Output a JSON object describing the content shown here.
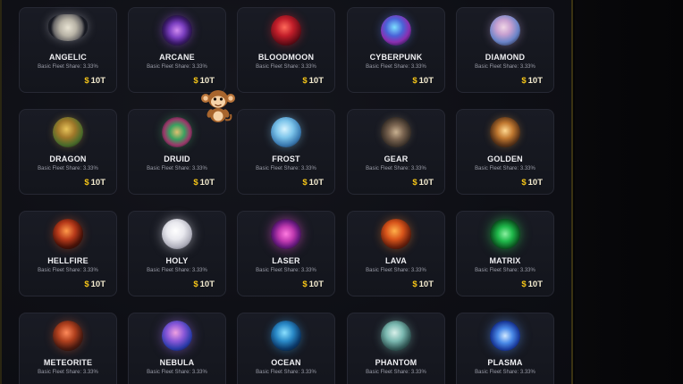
{
  "colors": {
    "accent_gold": "#f5c518",
    "card_bg": "#171922",
    "panel_border": "#3a3212"
  },
  "currency_symbol": "$",
  "cards": [
    {
      "name": "ANGELIC",
      "share": "Basic Fleet Share: 3.33%",
      "price": "10T",
      "icon": "angelic-wings-orb-icon"
    },
    {
      "name": "ARCANE",
      "share": "Basic Fleet Share: 3.33%",
      "price": "10T",
      "icon": "arcane-orb-icon"
    },
    {
      "name": "BLOODMOON",
      "share": "Basic Fleet Share: 3.33%",
      "price": "10T",
      "icon": "bloodmoon-orb-icon"
    },
    {
      "name": "CYBERPUNK",
      "share": "Basic Fleet Share: 3.33%",
      "price": "10T",
      "icon": "cyberpunk-orb-icon"
    },
    {
      "name": "DIAMOND",
      "share": "Basic Fleet Share: 3.33%",
      "price": "10T",
      "icon": "diamond-orb-icon"
    },
    {
      "name": "DRAGON",
      "share": "Basic Fleet Share: 3.33%",
      "price": "10T",
      "icon": "dragon-orb-icon"
    },
    {
      "name": "DRUID",
      "share": "Basic Fleet Share: 3.33%",
      "price": "10T",
      "icon": "druid-orb-icon"
    },
    {
      "name": "FROST",
      "share": "Basic Fleet Share: 3.33%",
      "price": "10T",
      "icon": "frost-orb-icon"
    },
    {
      "name": "GEAR",
      "share": "Basic Fleet Share: 3.33%",
      "price": "10T",
      "icon": "gear-orb-icon"
    },
    {
      "name": "GOLDEN",
      "share": "Basic Fleet Share: 3.33%",
      "price": "10T",
      "icon": "golden-orb-icon"
    },
    {
      "name": "HELLFIRE",
      "share": "Basic Fleet Share: 3.33%",
      "price": "10T",
      "icon": "hellfire-orb-icon"
    },
    {
      "name": "HOLY",
      "share": "Basic Fleet Share: 3.33%",
      "price": "10T",
      "icon": "holy-orb-icon"
    },
    {
      "name": "LASER",
      "share": "Basic Fleet Share: 3.33%",
      "price": "10T",
      "icon": "laser-orb-icon"
    },
    {
      "name": "LAVA",
      "share": "Basic Fleet Share: 3.33%",
      "price": "10T",
      "icon": "lava-orb-icon"
    },
    {
      "name": "MATRIX",
      "share": "Basic Fleet Share: 3.33%",
      "price": "10T",
      "icon": "matrix-orb-icon"
    },
    {
      "name": "METEORITE",
      "share": "Basic Fleet Share: 3.33%",
      "price": "",
      "icon": "meteorite-orb-icon"
    },
    {
      "name": "NEBULA",
      "share": "Basic Fleet Share: 3.33%",
      "price": "",
      "icon": "nebula-orb-icon"
    },
    {
      "name": "OCEAN",
      "share": "Basic Fleet Share: 3.33%",
      "price": "",
      "icon": "ocean-orb-icon"
    },
    {
      "name": "PHANTOM",
      "share": "Basic Fleet Share: 3.33%",
      "price": "",
      "icon": "phantom-orb-icon"
    },
    {
      "name": "PLASMA",
      "share": "Basic Fleet Share: 3.33%",
      "price": "",
      "icon": "plasma-orb-icon"
    }
  ],
  "mascot_icon": "monkey-mascot-icon"
}
